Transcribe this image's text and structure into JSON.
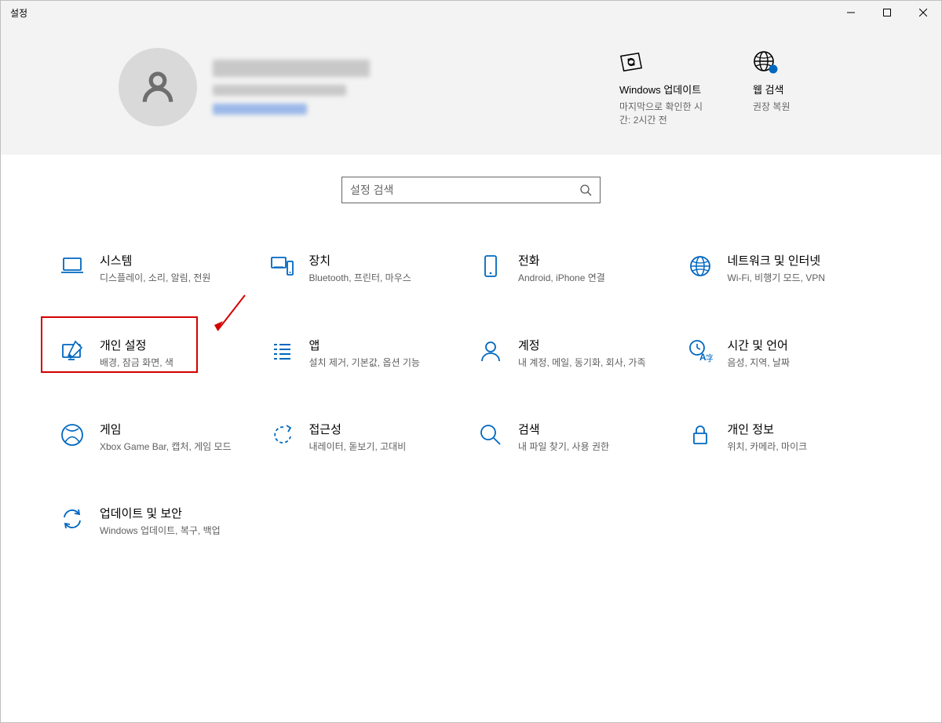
{
  "window": {
    "title": "설정"
  },
  "header": {
    "update": {
      "title": "Windows 업데이트",
      "sub": "마지막으로 확인한 시간: 2시간 전"
    },
    "websearch": {
      "title": "웹 검색",
      "sub": "권장 복원"
    }
  },
  "search": {
    "placeholder": "설정 검색"
  },
  "cards": {
    "system": {
      "title": "시스템",
      "sub": "디스플레이, 소리, 알림, 전원"
    },
    "devices": {
      "title": "장치",
      "sub": "Bluetooth, 프린터, 마우스"
    },
    "phone": {
      "title": "전화",
      "sub": "Android, iPhone 연결"
    },
    "network": {
      "title": "네트워크 및 인터넷",
      "sub": "Wi-Fi, 비행기 모드, VPN"
    },
    "personalization": {
      "title": "개인 설정",
      "sub": "배경, 잠금 화면, 색"
    },
    "apps": {
      "title": "앱",
      "sub": "설치 제거, 기본값, 옵션 기능"
    },
    "accounts": {
      "title": "계정",
      "sub": "내 계정, 메일, 동기화, 회사, 가족"
    },
    "time": {
      "title": "시간 및 언어",
      "sub": "음성, 지역, 날짜"
    },
    "gaming": {
      "title": "게임",
      "sub": "Xbox Game Bar, 캡처, 게임 모드"
    },
    "ease": {
      "title": "접근성",
      "sub": "내레이터, 돋보기, 고대비"
    },
    "searchc": {
      "title": "검색",
      "sub": "내 파일 찾기, 사용 권한"
    },
    "privacy": {
      "title": "개인 정보",
      "sub": "위치, 카메라, 마이크"
    },
    "update": {
      "title": "업데이트 및 보안",
      "sub": "Windows 업데이트, 복구, 백업"
    }
  },
  "colors": {
    "accent": "#0067c0",
    "highlight": "#d40000"
  }
}
